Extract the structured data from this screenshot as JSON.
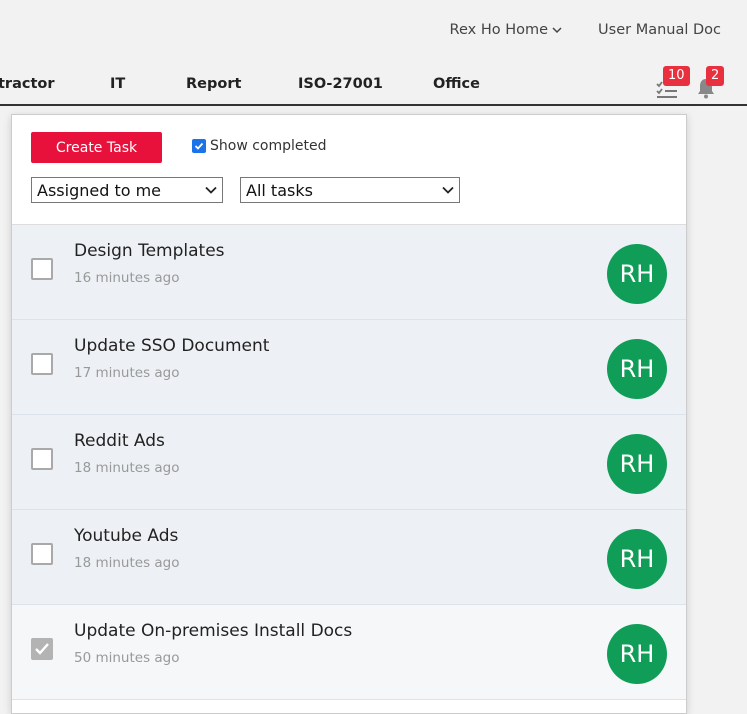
{
  "header": {
    "home_link": "Rex Ho Home",
    "manual_link": "User Manual Doc"
  },
  "nav": {
    "items": [
      "tractor",
      "IT",
      "Report",
      "ISO-27001",
      "Office"
    ],
    "tasks_badge": "10",
    "notifications_badge": "2"
  },
  "panel": {
    "create_label": "Create Task",
    "show_completed_label": "Show completed",
    "show_completed_checked": true,
    "filter_assignee": "Assigned to me",
    "filter_tasks": "All tasks"
  },
  "tasks": [
    {
      "title": "Design Templates",
      "time": "16 minutes ago",
      "avatar": "RH",
      "done": false
    },
    {
      "title": "Update SSO Document",
      "time": "17 minutes ago",
      "avatar": "RH",
      "done": false
    },
    {
      "title": "Reddit Ads",
      "time": "18 minutes ago",
      "avatar": "RH",
      "done": false
    },
    {
      "title": "Youtube Ads",
      "time": "18 minutes ago",
      "avatar": "RH",
      "done": false
    },
    {
      "title": "Update On-premises Install Docs",
      "time": "50 minutes ago",
      "avatar": "RH",
      "done": true
    }
  ],
  "colors": {
    "accent": "#e8113b",
    "avatar": "#0f9d58",
    "badge": "#e8303e"
  }
}
